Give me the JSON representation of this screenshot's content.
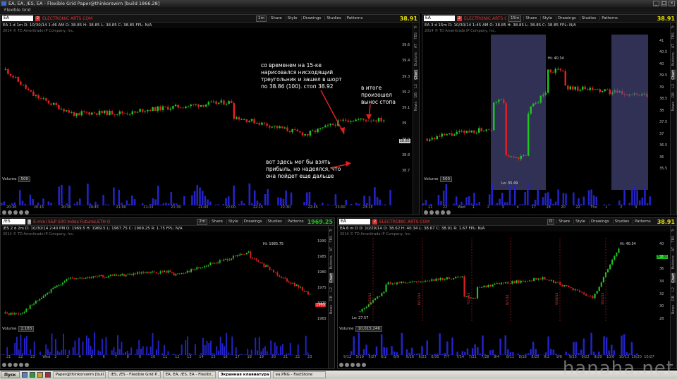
{
  "window": {
    "title": "EA, EA, /ES, EA - Flexible Grid Paper@thinkorswim [build 1866.28]",
    "menu": "Flexible Grid"
  },
  "header_buttons": {
    "share": "Share",
    "style": "Style",
    "drawings": "Drawings",
    "studies": "Studies",
    "patterns": "Patterns"
  },
  "pane1": {
    "symbol": "EA",
    "desc": "ELECTRONIC ARTS COM",
    "tf": "1m",
    "last": "38.91",
    "ohlc": "EA 1 d 1m  D: 10/30/14 1:46 AM  O: 38.85  H: 38.85  L: 38.85  C: 38.85  FPL: N/A",
    "copyright": "2014 © TD Ameritrade IP Company, Inc.",
    "yticks": [
      "39.6",
      "39.4",
      "39.3",
      "39.2",
      "39.1",
      "39",
      "38.9",
      "38.8",
      "38.7"
    ],
    "price_tag": "38.85",
    "volume_label": "Volume",
    "volume_value": "500",
    "vol_ticks": [
      "60,000",
      "40,000",
      "20,000"
    ],
    "xticks": [
      "20:30",
      "20:15",
      "20:30",
      "20:45",
      "21:00",
      "21:15",
      "21:30",
      "21:45",
      "22:00",
      "22:15",
      "22:30",
      "22:45",
      "23:00",
      "23:15"
    ]
  },
  "pane2": {
    "symbol": "EA",
    "desc": "ELECTRONIC ARTS C",
    "tf": "15m",
    "last": "38.91",
    "ohlc": "EA 3 d 15m  D: 10/30/14 1:45 AM  O: 38.85  H: 38.85  L: 38.85  C: 38.85  FPL: N/A",
    "copyright": "2014 © TD Ameritrade IP Company, Inc.",
    "hi": "Hi: 40.34",
    "lo": "Lo: 35.49",
    "yticks": [
      "41",
      "40.5",
      "40",
      "39.5",
      "39",
      "38.5",
      "38",
      "37.5",
      "37",
      "36.5",
      "36",
      "35.5"
    ],
    "volume_label": "Volume",
    "volume_value": "500",
    "vol_ticks": [
      "1.5",
      "1",
      "0.5"
    ],
    "xticks": [
      "21",
      "22",
      "Wed",
      "1",
      "2",
      "3",
      "4",
      "17",
      "18",
      "20",
      "22",
      "Thu",
      "1",
      "2",
      "3"
    ]
  },
  "pane3": {
    "symbol": "/ES",
    "desc": "E-mini S&P 500 Index Futures,ETH (DEC 14)",
    "tf": "2m",
    "last": "1969.25",
    "ohlc": "/ES 2 d 2m  D: 10/30/14 2:40 PM  O: 1969.5  H: 1969.5  L: 1967.75  C: 1969.25  R: 1.75  FPL: N/A",
    "copyright": "2014 © TD Ameritrade IP Company, Inc.",
    "hi": "Hi: 1985.75",
    "yticks": [
      "1990",
      "1985",
      "1980",
      "1975",
      "1970",
      "1965"
    ],
    "price_tag": "1969",
    "volume_label": "Volume",
    "volume_value": "2,183",
    "vol_ticks": [
      "30,000",
      "20,000",
      "10,000"
    ],
    "xticks": [
      "21",
      "22",
      "23",
      "Wed",
      "2",
      "3",
      "4",
      "5",
      "6",
      "7",
      "8",
      "9",
      "10",
      "11",
      "12",
      "13",
      "14",
      "15",
      "16",
      "17",
      "18",
      "19",
      "20",
      "21",
      "22",
      "23"
    ]
  },
  "pane4": {
    "symbol": "EA",
    "desc": "ELECTRONIC ARTS COM",
    "tf": "D",
    "last": "38.91",
    "ohlc": "EA 6 m D  D: 10/29/14  O: 38.62  H: 40.34  L: 38.67  C: 38.91  R: 1.67  FPL: N/A",
    "copyright": "2014 © TD Ameritrade IP Company, Inc.",
    "hi": "Hi: 40.34",
    "lo": "Lo: 27.57",
    "yticks": [
      "40",
      "38",
      "36",
      "34",
      "32",
      "30",
      "28"
    ],
    "price_tag": "38.91",
    "volume_label": "Volume",
    "volume_value": "10,015,246",
    "vol_ticks": [
      "15,000,000",
      "10,000,000",
      "5,000,000"
    ],
    "xticks": [
      "5/12",
      "5/19",
      "5/27",
      "6/2",
      "6/9",
      "6/16",
      "6/23",
      "6/30",
      "7/7",
      "7/14",
      "7/21",
      "7/28",
      "8/4",
      "8/11",
      "8/18",
      "8/25",
      "9/2",
      "9/8",
      "9/15",
      "9/22",
      "9/29",
      "10/6",
      "10/13",
      "10/20",
      "10/27"
    ],
    "date_marks": [
      "5/22/14",
      "6/17/14",
      "7/22/14",
      "8/7/14",
      "9/18/14",
      "10/1/14"
    ]
  },
  "side_tabs": [
    "Tr",
    "TBS",
    "AT",
    "Buttons",
    "Chart",
    "L2",
    "DB",
    "News"
  ],
  "annotations": {
    "note1": "со временем на 15-ке нарисовался нисходящий треугольник и зашел в шорт по 38.86 (100). стоп 38.92",
    "note2": "в итоге произошел вынос стопа",
    "note3": "вот здесь мог бы взять прибыль, но надеялся, что она пойдет еще дальше"
  },
  "taskbar": {
    "start": "Пуск",
    "items": [
      "Paper@thinkorswim [buil...",
      "/ES, /ES - Flexible Grid P...",
      "EA, EA, /ES, EA - Flexibl...",
      "Экранная клавиатура",
      "ea.PNG - FastStone"
    ]
  },
  "watermark": "hanaha.net",
  "colors": {
    "up": "#1fc41f",
    "down": "#e02020",
    "volume": "#2323c8",
    "yellow": "#e8e000",
    "highlight": "#5a5a9a"
  }
}
